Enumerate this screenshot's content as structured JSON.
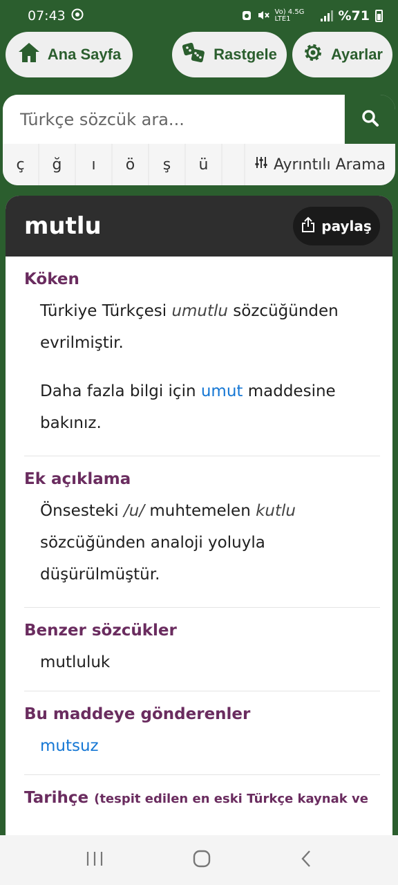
{
  "status": {
    "time": "07:43",
    "network": "Vo) 4.5G LTE1",
    "battery": "%71"
  },
  "nav": {
    "home": "Ana Sayfa",
    "random": "Rastgele",
    "settings": "Ayarlar"
  },
  "search": {
    "placeholder": "Türkçe sözcük ara..."
  },
  "chars": [
    "ç",
    "ğ",
    "ı",
    "ö",
    "ş",
    "ü",
    ""
  ],
  "advanced_search": "Ayrıntılı Arama",
  "entry": {
    "word": "mutlu",
    "share": "paylaş",
    "koken": {
      "title": "Köken",
      "p1_a": "Türkiye Türkçesi ",
      "p1_em": "umutlu",
      "p1_b": " sözcüğünden evrilmiştir.",
      "p2_a": "Daha fazla bilgi için ",
      "p2_link": "umut",
      "p2_b": " maddesine bakınız."
    },
    "ek": {
      "title": "Ek açıklama",
      "a": "Önsesteki ",
      "em1": "/u/",
      "b": " muhtemelen ",
      "em2": "kutlu",
      "c": " sözcüğünden analoji yoluyla düşürülmüştür."
    },
    "benzer": {
      "title": "Benzer sözcükler",
      "items": "mutluluk"
    },
    "gonderen": {
      "title": "Bu maddeye gönderenler",
      "items": "mutsuz"
    },
    "tarihce": {
      "title": "Tarihçe",
      "subtitle": "(tespit edilen en eski Türkçe kaynak ve"
    }
  }
}
